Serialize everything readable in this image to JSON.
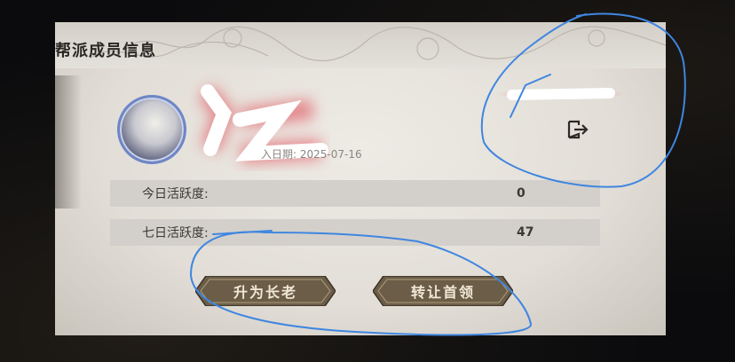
{
  "panel": {
    "title": "帮派成员信息",
    "join_date": "入日期: 2025-07-16"
  },
  "stats": [
    {
      "label": "今日活跃度:",
      "value": "0"
    },
    {
      "label": "七日活跃度:",
      "value": "47"
    }
  ],
  "buttons": {
    "promote_label": "升为长老",
    "transfer_label": "转让首领"
  },
  "icons": {
    "exit": "exit-icon"
  },
  "colors": {
    "panel_bg": "#e6e3dd",
    "button_bg": "#6b5d47",
    "annotation_blue": "#3f86e0",
    "redaction_red": "#e03040"
  }
}
